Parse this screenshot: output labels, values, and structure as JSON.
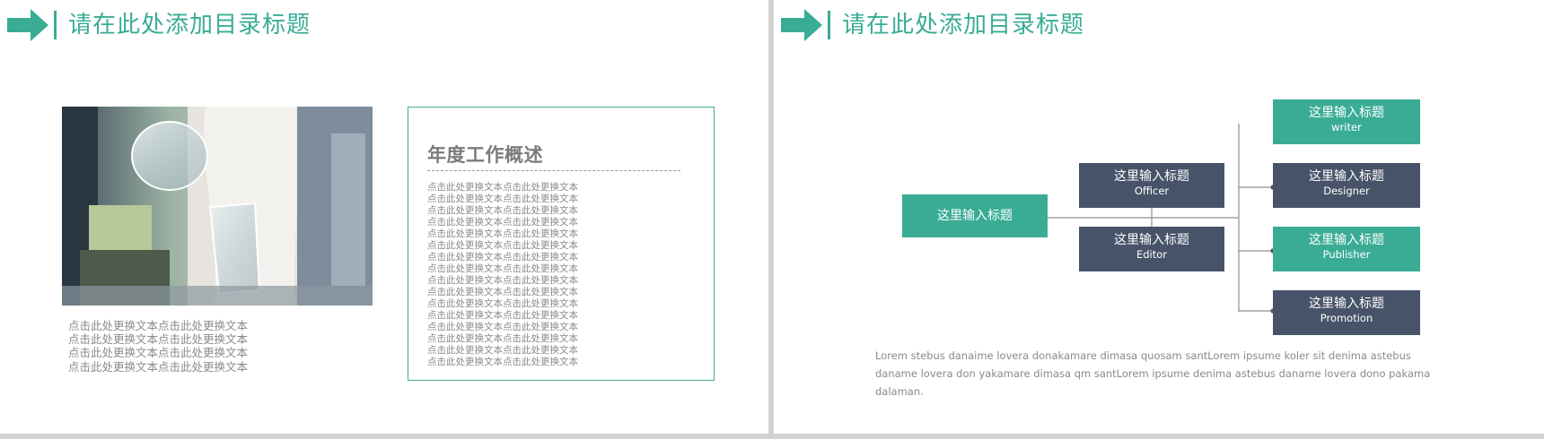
{
  "colors": {
    "accent": "#3aac96",
    "accent_dark": "#2f9c86",
    "navy": "#475369",
    "text_gray": "#8a8a8a",
    "title_gray": "#7b7b7b"
  },
  "left_slide": {
    "title": "请在此处添加目录标题",
    "photo": {
      "description_icon": "lab-photo"
    },
    "photo_caption": [
      "点击此处更换文本点击此处更换文本",
      "点击此处更换文本点击此处更换文本",
      "点击此处更换文本点击此处更换文本",
      "点击此处更换文本点击此处更换文本"
    ],
    "overview": {
      "title": "年度工作概述",
      "lines": [
        "点击此处更换文本点击此处更换文本",
        "点击此处更换文本点击此处更换文本",
        "点击此处更换文本点击此处更换文本",
        "点击此处更换文本点击此处更换文本",
        "点击此处更换文本点击此处更换文本",
        "点击此处更换文本点击此处更换文本",
        "点击此处更换文本点击此处更换文本",
        "点击此处更换文本点击此处更换文本",
        "点击此处更换文本点击此处更换文本",
        "点击此处更换文本点击此处更换文本",
        "点击此处更换文本点击此处更换文本",
        "点击此处更换文本点击此处更换文本",
        "点击此处更换文本点击此处更换文本",
        "点击此处更换文本点击此处更换文本",
        "点击此处更换文本点击此处更换文本",
        "点击此处更换文本点击此处更换文本"
      ]
    }
  },
  "right_slide": {
    "title": "请在此处添加目录标题",
    "root": {
      "title": "这里输入标题"
    },
    "middle": [
      {
        "title": "这里输入标题",
        "subtitle": "Officer"
      },
      {
        "title": "这里输入标题",
        "subtitle": "Editor"
      }
    ],
    "leaves": [
      {
        "title": "这里输入标题",
        "subtitle": "writer"
      },
      {
        "title": "这里输入标题",
        "subtitle": "Designer"
      },
      {
        "title": "这里输入标题",
        "subtitle": "Publisher"
      },
      {
        "title": "这里输入标题",
        "subtitle": "Promotion"
      }
    ],
    "footer": "Lorem stebus danaime lovera donakamare dimasa quosam santLorem ipsume koler sit denima astebus daname lovera don yakamare dimasa qm santLorem ipsume denima astebus daname lovera dono pakama dalaman."
  }
}
